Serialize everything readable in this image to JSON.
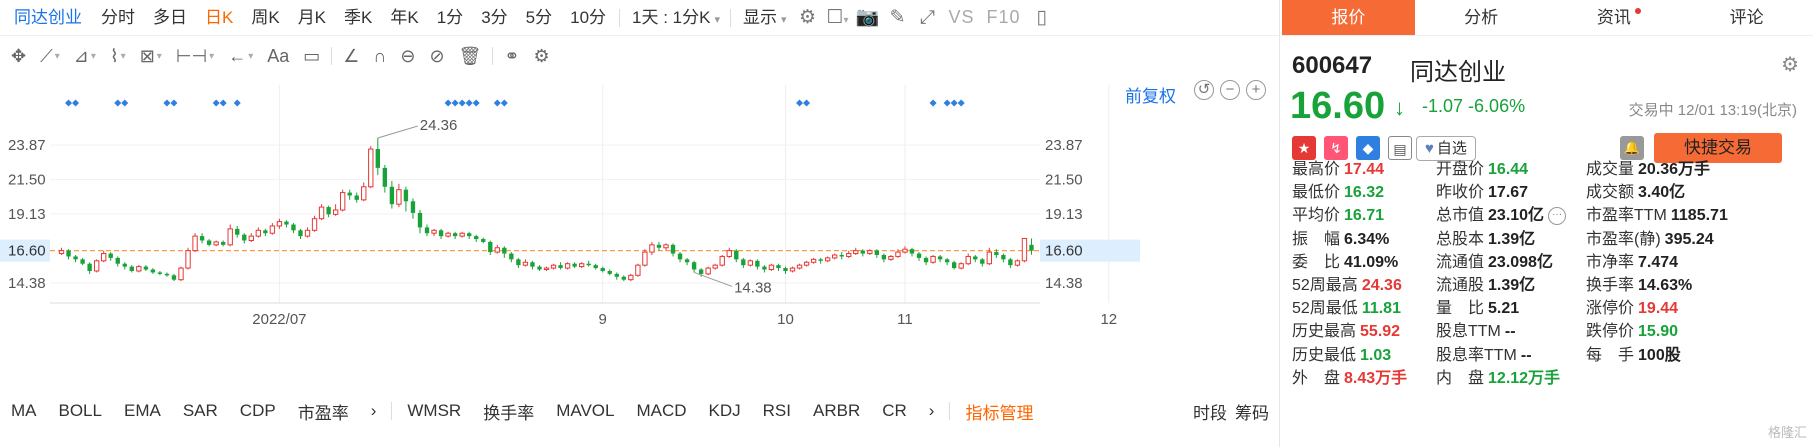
{
  "period_bar": {
    "title": "同达创业",
    "periods": [
      "分时",
      "多日",
      "日K",
      "周K",
      "月K",
      "季K",
      "年K",
      "1分",
      "3分",
      "5分",
      "10分"
    ],
    "active": "日K",
    "interval_dropdown": "1天 : 1分K",
    "display_label": "显示",
    "vs_label": "VS",
    "f10_label": "F10"
  },
  "draw_toolbar": {
    "aa_label": "Aa"
  },
  "chart_header": {
    "restore_label": "前复权"
  },
  "colors": {
    "up": "#e53935",
    "down": "#18a23a",
    "accent": "#f66a36",
    "link": "#1a73e8",
    "marker": "#2f7fe0",
    "current_line": "#ff9944"
  },
  "chart_data": {
    "type": "candlestick",
    "y_ticks": [
      "23.87",
      "21.50",
      "19.13",
      "16.60",
      "14.38"
    ],
    "y_tick_values": [
      23.87,
      21.5,
      19.13,
      16.6,
      14.38
    ],
    "ylim": [
      13.2,
      25.6
    ],
    "current_price": 16.6,
    "current_price_label": "16.60",
    "x_tick_labels": [
      "2022/07",
      "9",
      "10",
      "11",
      "12"
    ],
    "x_tick_index": [
      31,
      77,
      103,
      120,
      149
    ],
    "max_label": "24.36",
    "min_label": "14.38",
    "max_index": 45,
    "min_index": 90,
    "marker_index": [
      1,
      2,
      8,
      9,
      15,
      16,
      22,
      23,
      25,
      55,
      56,
      57,
      58,
      59,
      62,
      63,
      105,
      106,
      124,
      126,
      127,
      128
    ],
    "candles": [
      [
        16.4,
        16.6,
        16.8,
        16.3
      ],
      [
        16.6,
        16.2,
        16.7,
        16.0
      ],
      [
        16.2,
        16.0,
        16.3,
        15.8
      ],
      [
        16.0,
        15.7,
        16.1,
        15.6
      ],
      [
        15.7,
        15.2,
        15.8,
        15.0
      ],
      [
        15.2,
        15.9,
        16.0,
        15.1
      ],
      [
        15.9,
        16.4,
        16.6,
        15.8
      ],
      [
        16.4,
        16.1,
        16.5,
        15.9
      ],
      [
        16.1,
        15.7,
        16.2,
        15.5
      ],
      [
        15.7,
        15.5,
        15.8,
        15.3
      ],
      [
        15.5,
        15.2,
        15.6,
        15.1
      ],
      [
        15.2,
        15.5,
        15.6,
        15.1
      ],
      [
        15.5,
        15.3,
        15.6,
        15.2
      ],
      [
        15.3,
        15.1,
        15.4,
        15.0
      ],
      [
        15.1,
        15.0,
        15.2,
        14.9
      ],
      [
        15.0,
        14.9,
        15.1,
        14.8
      ],
      [
        14.9,
        14.6,
        15.0,
        14.5
      ],
      [
        14.6,
        15.4,
        15.5,
        14.5
      ],
      [
        15.4,
        16.6,
        16.8,
        15.3
      ],
      [
        16.6,
        17.6,
        17.8,
        16.5
      ],
      [
        17.6,
        17.3,
        17.8,
        17.1
      ],
      [
        17.3,
        17.0,
        17.4,
        16.9
      ],
      [
        17.0,
        17.2,
        17.3,
        16.9
      ],
      [
        17.2,
        17.0,
        17.3,
        16.9
      ],
      [
        17.0,
        18.1,
        18.4,
        16.9
      ],
      [
        18.1,
        17.7,
        18.3,
        17.5
      ],
      [
        17.7,
        17.3,
        17.8,
        17.1
      ],
      [
        17.3,
        17.6,
        17.8,
        17.2
      ],
      [
        17.6,
        18.0,
        18.2,
        17.5
      ],
      [
        18.0,
        17.8,
        18.1,
        17.6
      ],
      [
        17.8,
        18.3,
        18.5,
        17.7
      ],
      [
        18.3,
        18.6,
        18.8,
        18.1
      ],
      [
        18.6,
        18.4,
        18.7,
        18.2
      ],
      [
        18.4,
        18.0,
        18.5,
        17.8
      ],
      [
        18.0,
        17.6,
        18.1,
        17.4
      ],
      [
        17.6,
        18.0,
        18.2,
        17.5
      ],
      [
        18.0,
        18.8,
        19.0,
        17.9
      ],
      [
        18.8,
        19.6,
        19.8,
        18.7
      ],
      [
        19.6,
        19.1,
        19.7,
        18.9
      ],
      [
        19.1,
        19.4,
        19.8,
        19.0
      ],
      [
        19.4,
        20.6,
        20.8,
        19.3
      ],
      [
        20.6,
        20.4,
        20.8,
        20.1
      ],
      [
        20.4,
        20.1,
        20.6,
        19.9
      ],
      [
        20.1,
        21.0,
        21.3,
        20.0
      ],
      [
        21.0,
        23.6,
        23.8,
        20.9
      ],
      [
        23.6,
        22.3,
        24.36,
        21.8
      ],
      [
        22.3,
        21.0,
        22.5,
        20.6
      ],
      [
        21.0,
        19.8,
        21.4,
        19.5
      ],
      [
        19.8,
        20.8,
        21.2,
        19.6
      ],
      [
        20.8,
        20.0,
        21.0,
        19.3
      ],
      [
        20.0,
        19.2,
        20.2,
        18.8
      ],
      [
        19.2,
        18.2,
        19.4,
        17.8
      ],
      [
        18.2,
        17.8,
        18.4,
        17.6
      ],
      [
        17.8,
        18.0,
        18.1,
        17.6
      ],
      [
        18.0,
        17.6,
        18.1,
        17.4
      ],
      [
        17.6,
        17.8,
        17.9,
        17.5
      ],
      [
        17.8,
        17.6,
        17.9,
        17.4
      ],
      [
        17.6,
        17.8,
        17.9,
        17.5
      ],
      [
        17.8,
        17.6,
        17.9,
        17.4
      ],
      [
        17.6,
        17.4,
        17.7,
        17.2
      ],
      [
        17.4,
        17.2,
        17.5,
        17.1
      ],
      [
        17.2,
        16.5,
        17.3,
        16.3
      ],
      [
        16.5,
        16.8,
        17.0,
        16.4
      ],
      [
        16.8,
        16.4,
        16.9,
        16.1
      ],
      [
        16.4,
        16.0,
        16.5,
        15.8
      ],
      [
        16.0,
        15.6,
        16.1,
        15.4
      ],
      [
        15.6,
        15.8,
        16.0,
        15.5
      ],
      [
        15.8,
        15.5,
        15.9,
        15.3
      ],
      [
        15.5,
        15.3,
        15.6,
        15.2
      ],
      [
        15.3,
        15.4,
        15.5,
        15.2
      ],
      [
        15.4,
        15.6,
        15.7,
        15.3
      ],
      [
        15.6,
        15.4,
        15.8,
        15.3
      ],
      [
        15.4,
        15.7,
        15.8,
        15.3
      ],
      [
        15.7,
        15.5,
        15.8,
        15.4
      ],
      [
        15.5,
        15.7,
        15.8,
        15.4
      ],
      [
        15.7,
        15.6,
        15.9,
        15.5
      ],
      [
        15.6,
        15.4,
        15.7,
        15.3
      ],
      [
        15.4,
        15.2,
        15.5,
        15.1
      ],
      [
        15.2,
        15.0,
        15.3,
        14.9
      ],
      [
        15.0,
        14.8,
        15.1,
        14.6
      ],
      [
        14.8,
        14.6,
        14.9,
        14.5
      ],
      [
        14.6,
        14.9,
        15.0,
        14.5
      ],
      [
        14.9,
        15.6,
        15.7,
        14.8
      ],
      [
        15.6,
        16.5,
        16.7,
        15.5
      ],
      [
        16.5,
        17.0,
        17.2,
        16.3
      ],
      [
        17.0,
        16.8,
        17.2,
        16.6
      ],
      [
        16.8,
        17.0,
        17.1,
        16.6
      ],
      [
        17.0,
        16.4,
        17.1,
        16.2
      ],
      [
        16.4,
        16.0,
        16.5,
        15.8
      ],
      [
        16.0,
        15.8,
        16.1,
        15.6
      ],
      [
        15.8,
        15.3,
        15.9,
        15.1
      ],
      [
        15.3,
        15.0,
        15.4,
        14.8
      ],
      [
        15.0,
        15.4,
        15.5,
        14.9
      ],
      [
        15.4,
        15.6,
        15.7,
        15.3
      ],
      [
        15.6,
        16.2,
        16.3,
        15.5
      ],
      [
        16.2,
        16.6,
        16.8,
        16.1
      ],
      [
        16.6,
        16.0,
        16.7,
        15.8
      ],
      [
        16.0,
        15.6,
        16.1,
        15.4
      ],
      [
        15.6,
        15.9,
        16.0,
        15.5
      ],
      [
        15.9,
        15.5,
        16.0,
        15.3
      ],
      [
        15.5,
        15.3,
        15.6,
        15.1
      ],
      [
        15.3,
        15.6,
        15.7,
        15.2
      ],
      [
        15.6,
        15.4,
        15.7,
        15.2
      ],
      [
        15.4,
        15.2,
        15.5,
        15.0
      ],
      [
        15.2,
        15.4,
        15.5,
        15.1
      ],
      [
        15.4,
        15.6,
        15.7,
        15.3
      ],
      [
        15.6,
        15.8,
        15.9,
        15.5
      ],
      [
        15.8,
        16.0,
        16.1,
        15.7
      ],
      [
        16.0,
        15.9,
        16.1,
        15.7
      ],
      [
        15.9,
        16.1,
        16.2,
        15.8
      ],
      [
        16.1,
        16.3,
        16.4,
        16.0
      ],
      [
        16.3,
        16.2,
        16.5,
        16.0
      ],
      [
        16.2,
        16.4,
        16.6,
        16.1
      ],
      [
        16.4,
        16.6,
        16.8,
        16.3
      ],
      [
        16.6,
        16.4,
        16.7,
        16.2
      ],
      [
        16.4,
        16.6,
        16.7,
        16.3
      ],
      [
        16.6,
        16.3,
        16.7,
        16.1
      ],
      [
        16.3,
        16.0,
        16.4,
        15.8
      ],
      [
        16.0,
        16.2,
        16.3,
        15.9
      ],
      [
        16.2,
        16.5,
        16.7,
        16.1
      ],
      [
        16.5,
        16.7,
        16.9,
        16.4
      ],
      [
        16.7,
        16.4,
        16.8,
        16.2
      ],
      [
        16.4,
        16.1,
        16.5,
        15.9
      ],
      [
        16.1,
        15.8,
        16.2,
        15.6
      ],
      [
        15.8,
        16.2,
        16.3,
        15.7
      ],
      [
        16.2,
        16.0,
        16.3,
        15.8
      ],
      [
        16.0,
        15.8,
        16.1,
        15.6
      ],
      [
        15.8,
        15.4,
        15.9,
        15.3
      ],
      [
        15.4,
        15.7,
        15.8,
        15.3
      ],
      [
        15.7,
        16.2,
        16.4,
        15.6
      ],
      [
        16.2,
        16.0,
        16.3,
        15.8
      ],
      [
        16.0,
        15.7,
        16.1,
        15.5
      ],
      [
        15.7,
        16.5,
        16.8,
        15.6
      ],
      [
        16.5,
        16.3,
        16.7,
        16.1
      ],
      [
        16.3,
        16.0,
        16.4,
        15.8
      ],
      [
        16.0,
        15.6,
        16.1,
        15.4
      ],
      [
        15.6,
        15.9,
        16.0,
        15.5
      ],
      [
        15.9,
        17.44,
        17.44,
        15.8
      ],
      [
        17.0,
        16.6,
        17.44,
        16.32
      ]
    ]
  },
  "indicator_bar": {
    "items": [
      "MA",
      "BOLL",
      "EMA",
      "SAR",
      "CDP",
      "市盈率"
    ],
    "items2": [
      "WMSR",
      "换手率",
      "MAVOL",
      "MACD",
      "KDJ",
      "RSI",
      "ARBR",
      "CR"
    ],
    "manage_label": "指标管理",
    "right_items": [
      "时段",
      "筹码"
    ]
  },
  "quote": {
    "tabs": [
      "报价",
      "分析",
      "资讯",
      "评论"
    ],
    "code": "600647",
    "name": "同达创业",
    "price": "16.60",
    "change": "-1.07",
    "change_pct": "-6.06%",
    "status": "交易中 12/01 13:19(北京)",
    "watch_label": "自选",
    "quick_trade": "快捷交易",
    "stats": [
      [
        {
          "label": "最高价",
          "value": "17.44",
          "color": "red"
        },
        {
          "label": "开盘价",
          "value": "16.44",
          "color": "green"
        },
        {
          "label": "成交量",
          "value": "20.36万手",
          "color": "dark"
        }
      ],
      [
        {
          "label": "最低价",
          "value": "16.32",
          "color": "green"
        },
        {
          "label": "昨收价",
          "value": "17.67",
          "color": "dark"
        },
        {
          "label": "成交额",
          "value": "3.40亿",
          "color": "dark"
        }
      ],
      [
        {
          "label": "平均价",
          "value": "16.71",
          "color": "green"
        },
        {
          "label": "总市值",
          "value": "23.10亿",
          "color": "dark"
        },
        {
          "label": "市盈率TTM",
          "value": "1185.71",
          "color": "dark"
        }
      ],
      [
        {
          "label": "振　幅",
          "value": "6.34%",
          "color": "dark"
        },
        {
          "label": "总股本",
          "value": "1.39亿",
          "color": "dark"
        },
        {
          "label": "市盈率(静)",
          "value": "395.24",
          "color": "dark"
        }
      ],
      [
        {
          "label": "委　比",
          "value": "41.09%",
          "color": "dark"
        },
        {
          "label": "流通值",
          "value": "23.098亿",
          "color": "dark"
        },
        {
          "label": "市净率",
          "value": "7.474",
          "color": "dark"
        }
      ],
      [
        {
          "label": "52周最高",
          "value": "24.36",
          "color": "red"
        },
        {
          "label": "流通股",
          "value": "1.39亿",
          "color": "dark"
        },
        {
          "label": "换手率",
          "value": "14.63%",
          "color": "dark"
        }
      ],
      [
        {
          "label": "52周最低",
          "value": "11.81",
          "color": "green"
        },
        {
          "label": "量　比",
          "value": "5.21",
          "color": "dark"
        },
        {
          "label": "涨停价",
          "value": "19.44",
          "color": "red"
        }
      ],
      [
        {
          "label": "历史最高",
          "value": "55.92",
          "color": "red"
        },
        {
          "label": "股息TTM",
          "value": "--",
          "color": "dark"
        },
        {
          "label": "跌停价",
          "value": "15.90",
          "color": "green"
        }
      ],
      [
        {
          "label": "历史最低",
          "value": "1.03",
          "color": "green"
        },
        {
          "label": "股息率TTM",
          "value": "--",
          "color": "dark"
        },
        {
          "label": "每　手",
          "value": "100股",
          "color": "dark"
        }
      ],
      [
        {
          "label": "外　盘",
          "value": "8.43万手",
          "color": "red"
        },
        {
          "label": "内　盘",
          "value": "12.12万手",
          "color": "green"
        },
        {
          "label": "",
          "value": "",
          "color": "dark"
        }
      ]
    ],
    "watermark": "格隆汇"
  }
}
